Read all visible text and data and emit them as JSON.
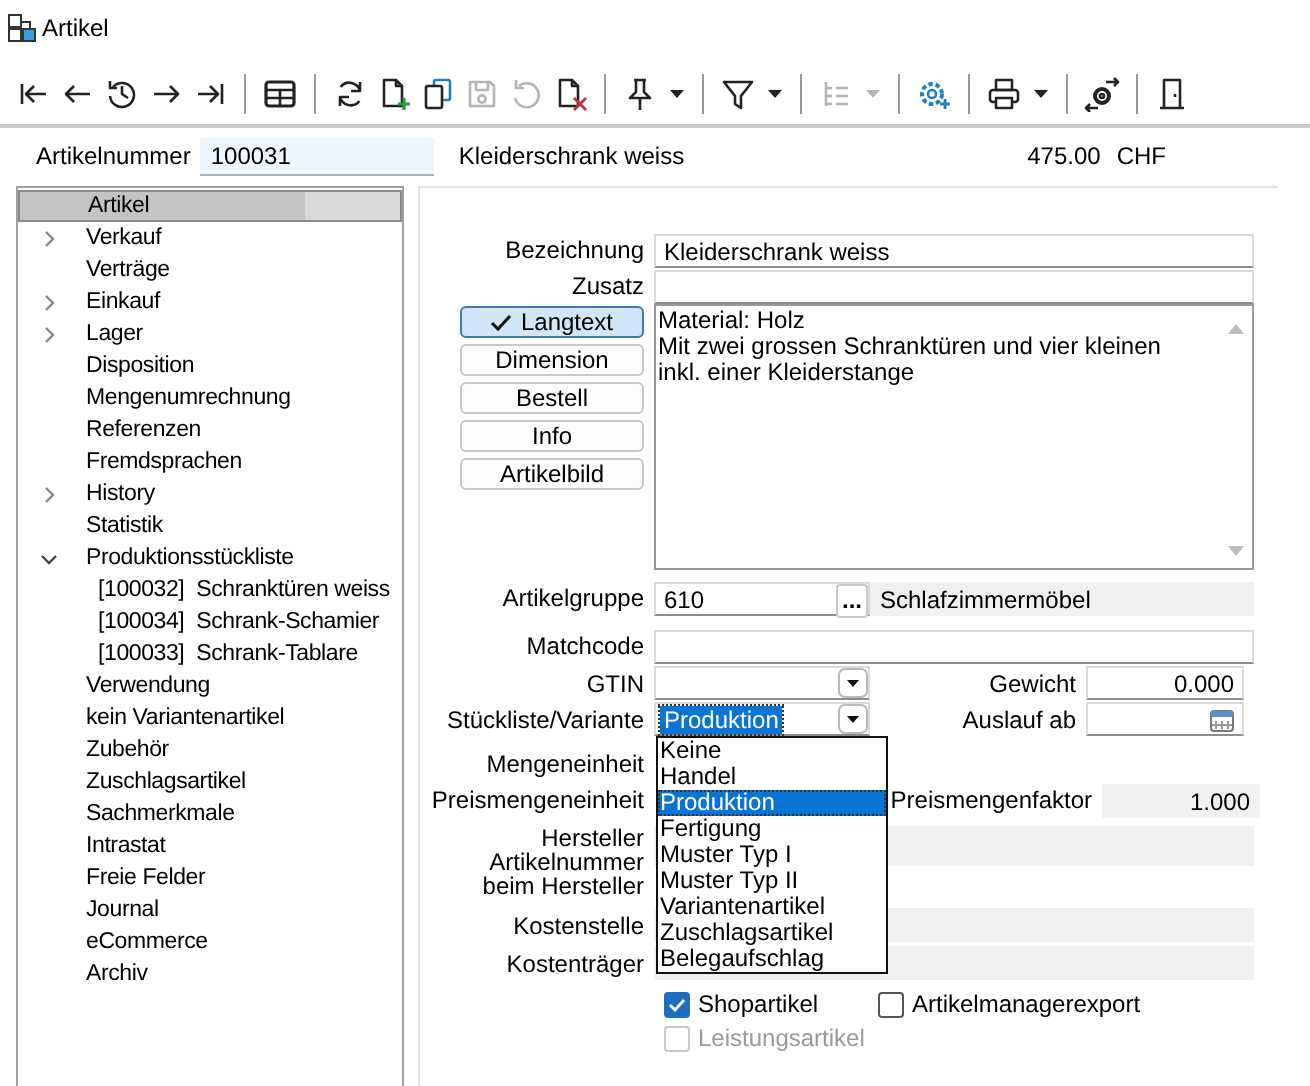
{
  "window": {
    "title": "Artikel"
  },
  "toolbar": [
    {
      "kind": "first",
      "disabled": false,
      "menu": false
    },
    {
      "kind": "back",
      "disabled": false,
      "menu": false
    },
    {
      "kind": "history",
      "disabled": false,
      "menu": false
    },
    {
      "kind": "forward",
      "disabled": false,
      "menu": false
    },
    {
      "kind": "last",
      "disabled": false,
      "menu": false
    },
    {
      "kind": "separator"
    },
    {
      "kind": "table",
      "disabled": false,
      "menu": false
    },
    {
      "kind": "separator"
    },
    {
      "kind": "refresh",
      "disabled": false,
      "menu": false
    },
    {
      "kind": "new",
      "disabled": false,
      "menu": false
    },
    {
      "kind": "copy",
      "disabled": false,
      "menu": false
    },
    {
      "kind": "save",
      "disabled": true,
      "menu": false
    },
    {
      "kind": "undo",
      "disabled": true,
      "menu": false
    },
    {
      "kind": "delete",
      "disabled": false,
      "menu": false
    },
    {
      "kind": "separator"
    },
    {
      "kind": "pin",
      "disabled": false,
      "menu": true
    },
    {
      "kind": "separator"
    },
    {
      "kind": "filter",
      "disabled": false,
      "menu": true
    },
    {
      "kind": "separator"
    },
    {
      "kind": "tree",
      "disabled": true,
      "menu": true
    },
    {
      "kind": "separator"
    },
    {
      "kind": "settings",
      "disabled": false,
      "menu": false
    },
    {
      "kind": "separator"
    },
    {
      "kind": "print",
      "disabled": false,
      "menu": true
    },
    {
      "kind": "separator"
    },
    {
      "kind": "transfer",
      "disabled": false,
      "menu": false
    },
    {
      "kind": "separator"
    },
    {
      "kind": "exit",
      "disabled": false,
      "menu": false
    }
  ],
  "header": {
    "label": "Artikelnummer",
    "value": "100031",
    "description": "Kleiderschrank weiss",
    "price": "475.00",
    "currency": "CHF"
  },
  "tree": [
    {
      "label": "Artikel",
      "selected": true
    },
    {
      "label": "Verkauf",
      "selected": false,
      "expanded": false
    },
    {
      "label": "Verträge",
      "selected": false
    },
    {
      "label": "Einkauf",
      "selected": false,
      "expanded": false
    },
    {
      "label": "Lager",
      "selected": false,
      "expanded": false
    },
    {
      "label": "Disposition",
      "selected": false
    },
    {
      "label": "Mengenumrechnung",
      "selected": false
    },
    {
      "label": "Referenzen",
      "selected": false
    },
    {
      "label": "Fremdsprachen",
      "selected": false
    },
    {
      "label": "History",
      "selected": false,
      "expanded": false
    },
    {
      "label": "Statistik",
      "selected": false
    },
    {
      "label": "Produktionsstückliste",
      "selected": false,
      "expanded": true,
      "children": [
        {
          "label": "[100032]  Schranktüren weiss",
          "selected": false
        },
        {
          "label": "[100034]  Schrank-Schamier",
          "selected": false
        },
        {
          "label": "[100033]  Schrank-Tablare",
          "selected": false
        }
      ]
    },
    {
      "label": "Verwendung",
      "selected": false
    },
    {
      "label": "kein Variantenartikel",
      "selected": false
    },
    {
      "label": "Zubehör",
      "selected": false
    },
    {
      "label": "Zuschlagsartikel",
      "selected": false
    },
    {
      "label": "Sachmerkmale",
      "selected": false
    },
    {
      "label": "Intrastat",
      "selected": false
    },
    {
      "label": "Freie Felder",
      "selected": false
    },
    {
      "label": "Journal",
      "selected": false
    },
    {
      "label": "eCommerce",
      "selected": false
    },
    {
      "label": "Archiv",
      "selected": false
    }
  ],
  "form": {
    "bezeichnung": {
      "label": "Bezeichnung",
      "value": "Kleiderschrank weiss"
    },
    "zusatz": {
      "label": "Zusatz"
    },
    "text_buttons": [
      {
        "label": "Langtext",
        "selected": true
      },
      {
        "label": "Dimension",
        "selected": false
      },
      {
        "label": "Bestell",
        "selected": false
      },
      {
        "label": "Info",
        "selected": false
      },
      {
        "label": "Artikelbild",
        "selected": false
      }
    ],
    "langtext": {
      "value": "Material: Holz\nMit zwei grossen Schranktüren und vier kleinen\ninkl. einer Kleiderstange"
    },
    "artikelgruppe": {
      "label": "Artikelgruppe",
      "value": "610",
      "button": "...",
      "description": "Schlafzimmermöbel"
    },
    "matchcode": {
      "label": "Matchcode"
    },
    "gtin": {
      "label": "GTIN"
    },
    "gewicht": {
      "label": "Gewicht",
      "value": "0.000"
    },
    "stueckliste": {
      "label": "Stückliste/Variante",
      "value": "Produktion",
      "expanded": true,
      "options": [
        {
          "label": "Keine",
          "selected": false
        },
        {
          "label": "Handel",
          "selected": false
        },
        {
          "label": "Produktion",
          "selected": true
        },
        {
          "label": "Fertigung",
          "selected": false
        },
        {
          "label": "Muster Typ I",
          "selected": false
        },
        {
          "label": "Muster Typ II",
          "selected": false
        },
        {
          "label": "Variantenartikel",
          "selected": false
        },
        {
          "label": "Zuschlagsartikel",
          "selected": false
        },
        {
          "label": "Belegaufschlag",
          "selected": false
        }
      ]
    },
    "auslauf": {
      "label": "Auslauf ab"
    },
    "mengeneinheit": {
      "label": "Mengeneinheit"
    },
    "preismengeneinheit": {
      "label": "Preismengeneinheit"
    },
    "preismengenfaktor": {
      "label": "Preismengenfaktor",
      "value": "1.000"
    },
    "hersteller_artikelnummer": {
      "label": "Hersteller\nArtikelnummer\nbeim Hersteller"
    },
    "kostenstelle": {
      "label": "Kostenstelle"
    },
    "kostentraeger": {
      "label": "Kostenträger"
    },
    "checkboxes": [
      {
        "label": "Shopartikel",
        "checked": true,
        "disabled": false
      },
      {
        "label": "Artikelmanagerexport",
        "checked": false,
        "disabled": false
      },
      {
        "label": "Leistungsartikel",
        "checked": false,
        "disabled": true
      }
    ]
  }
}
